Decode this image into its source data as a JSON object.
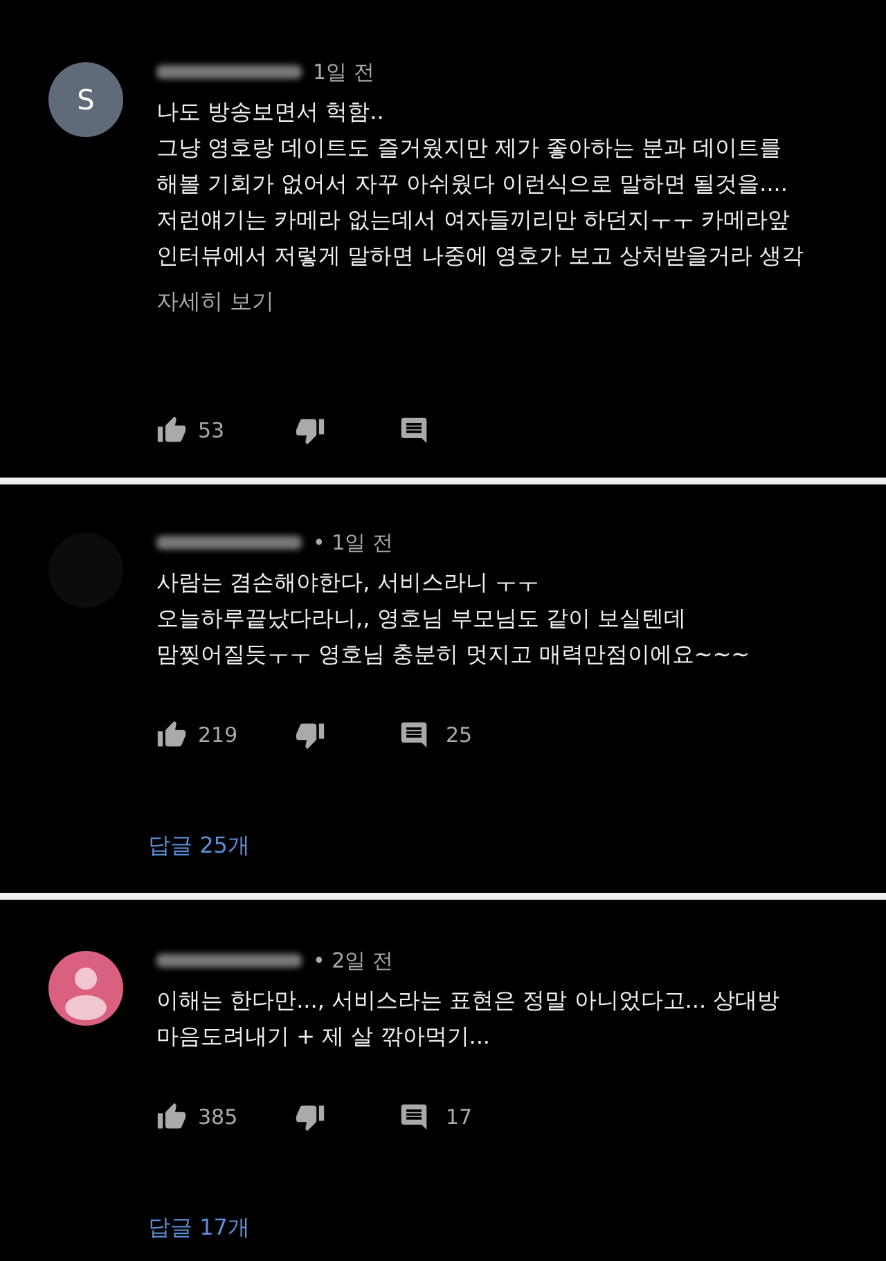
{
  "comments": [
    {
      "avatar": {
        "kind": "letter",
        "letter": "S"
      },
      "time": "1일 전",
      "lines": [
        "나도 방송보면서 헉함..",
        "그냥 영호랑 데이트도 즐거웠지만 제가 좋아하는 분과 데이트를",
        "해볼 기회가 없어서 자꾸 아쉬웠다 이런식으로 말하면 될것을....",
        "저런얘기는 카메라 없는데서 여자들끼리만 하던지ㅜㅜ 카메라앞",
        "인터뷰에서 저렇게 말하면 나중에 영호가 보고 상처받을거라 생각"
      ],
      "more_link": "자세히 보기",
      "likes": "53"
    },
    {
      "avatar": {
        "kind": "dark"
      },
      "time": "• 1일 전",
      "lines": [
        "사람는 겸손해야한다, 서비스라니 ㅜㅜ",
        "오늘하루끝났다라니,, 영호님 부모님도 같이 보실텐데",
        "맘찢어질듯ㅜㅜ 영호님 충분히 멋지고 매력만점이에요~~~"
      ],
      "likes": "219",
      "reply_count": "25",
      "replies_link": "답글 25개"
    },
    {
      "avatar": {
        "kind": "silhouette"
      },
      "time": "• 2일 전",
      "lines": [
        "이해는 한다만..., 서비스라는 표현은 정말 아니었다고...  상대방",
        "마음도려내기 + 제 살 깎아먹기..."
      ],
      "likes": "385",
      "reply_count": "17",
      "replies_link": "답글 17개"
    }
  ]
}
